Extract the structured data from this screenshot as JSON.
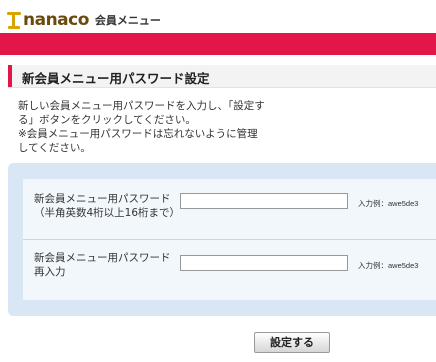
{
  "header": {
    "logo_text": "nanaco",
    "subtitle": "会員メニュー"
  },
  "page": {
    "title": "新会員メニュー用パスワード設定"
  },
  "description": {
    "line1": "新しい会員メニュー用パスワードを入力し、「設定する」ボタンをクリックしてください。",
    "line2": "※会員メニュー用パスワードは忘れないように管理してください。"
  },
  "form": {
    "password": {
      "label": "新会員メニュー用パスワード",
      "hint": "（半角英数4桁以上16桁まで）",
      "value": "",
      "example": "入力例：awe5de3"
    },
    "password_confirm": {
      "label": "新会員メニュー用パスワード再入力",
      "value": "",
      "example": "入力例：awe5de3"
    },
    "submit_label": "設定する"
  },
  "colors": {
    "brand_pink": "#e3164a",
    "logo_gold": "#d9a400",
    "panel_blue": "#d8e7f3"
  }
}
